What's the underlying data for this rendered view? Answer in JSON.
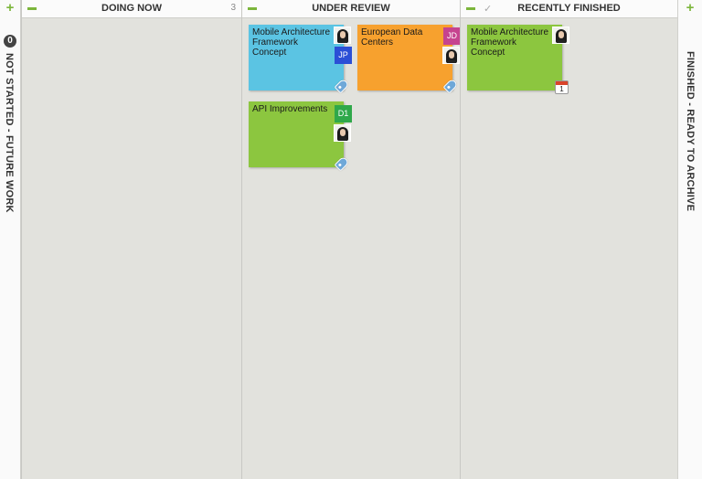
{
  "columns": {
    "not_started": {
      "title": "NOT STARTED - FUTURE WORK",
      "count": "0"
    },
    "doing_now": {
      "title": "DOING NOW",
      "count": "3"
    },
    "under_review": {
      "title": "UNDER REVIEW"
    },
    "recently_finished": {
      "title": "RECENTLY FINISHED"
    },
    "finished_archive": {
      "title": "FINISHED - READY TO ARCHIVE"
    }
  },
  "icons": {
    "add": "plus-icon",
    "collapse": "minus-icon",
    "done": "checkmark-icon",
    "tag": "tag-icon",
    "calendar": "calendar-icon"
  },
  "colors": {
    "accent_green": "#7cb63b",
    "card_blue": "#5bc4e3",
    "card_orange": "#f7a12e",
    "card_green": "#8cc63f"
  },
  "cards": [
    {
      "title": "Mobile Architecture Framework Concept",
      "color": "#5bc4e3",
      "initials": "JP",
      "initials_color": "#2b4fd6"
    },
    {
      "title": "European Data Centers",
      "color": "#f7a12e",
      "initials": "JD",
      "initials_color": "#c6438f"
    },
    {
      "title": "API Improvements",
      "color": "#8cc63f",
      "initials": "D1",
      "initials_color": "#2fa84a"
    },
    {
      "title": "Mobile Architecture Framework Concept",
      "color": "#8cc63f",
      "calendar_day": "1"
    }
  ]
}
